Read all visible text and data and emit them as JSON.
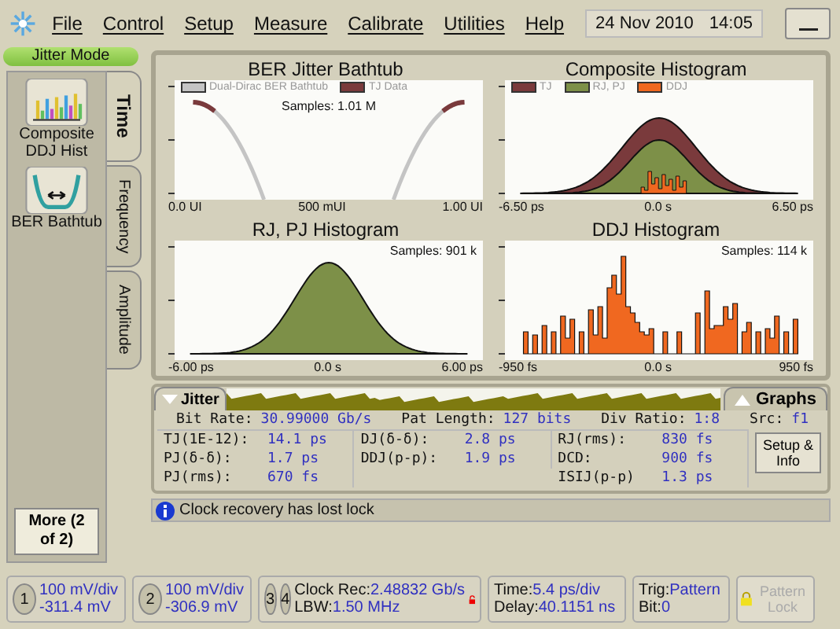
{
  "menu": [
    "File",
    "Control",
    "Setup",
    "Measure",
    "Calibrate",
    "Utilities",
    "Help"
  ],
  "date": "24 Nov 2010",
  "time": "14:05",
  "mode_label": "Jitter Mode",
  "sidebar_buttons": [
    {
      "kind": "histogram",
      "label": "Composite DDJ Hist"
    },
    {
      "kind": "bathtub",
      "label": "BER Bathtub"
    }
  ],
  "more_button": "More (2 of 2)",
  "tabs": [
    {
      "label": "Time",
      "selected": true
    },
    {
      "label": "Frequency",
      "selected": false
    },
    {
      "label": "Amplitude",
      "selected": false
    }
  ],
  "charts": [
    {
      "kind": "bathtub",
      "title": "BER Jitter Bathtub",
      "legend": [
        {
          "label": "Dual-Dirac BER Bathtub",
          "color": "#c4c4c4"
        },
        {
          "label": "TJ Data",
          "color": "#7a3a3c"
        }
      ],
      "samples": "Samples: 1.01 M",
      "x_ticks": [
        "0.0 UI",
        "500 mUI",
        "1.00 UI"
      ]
    },
    {
      "kind": "composite",
      "title": "Composite Histogram",
      "legend": [
        {
          "label": "TJ",
          "color": "#7a3a3c"
        },
        {
          "label": "RJ, PJ",
          "color": "#7d9048"
        },
        {
          "label": "DDJ",
          "color": "#f06820"
        }
      ],
      "x_ticks": [
        "-6.50 ps",
        "0.0 s",
        "6.50 ps"
      ]
    },
    {
      "kind": "gaussian",
      "title": "RJ, PJ Histogram",
      "samples": "Samples: 901 k",
      "x_ticks": [
        "-6.00 ps",
        "0.0 s",
        "6.00 ps"
      ]
    },
    {
      "kind": "ddj",
      "title": "DDJ Histogram",
      "samples": "Samples: 114 k",
      "x_ticks": [
        "-950 fs",
        "0.0 s",
        "950 fs"
      ]
    }
  ],
  "jitter_tab": "Jitter",
  "graphs_tab": "Graphs",
  "info": [
    {
      "label": "Bit Rate:",
      "value": "30.99000 Gb/s"
    },
    {
      "label": "Pat Length:",
      "value": "127 bits"
    },
    {
      "label": "Div Ratio:",
      "value": "1:8"
    },
    {
      "label": "Src:",
      "value": "f1"
    }
  ],
  "results": [
    [
      {
        "label": "TJ(1E-12):",
        "value": "14.1 ps"
      },
      {
        "label": "PJ(δ-δ):",
        "value": "1.7 ps"
      },
      {
        "label": "PJ(rms):",
        "value": "670 fs"
      }
    ],
    [
      {
        "label": "DJ(δ-δ):",
        "value": "2.8 ps"
      },
      {
        "label": "DDJ(p-p):",
        "value": "1.9 ps"
      }
    ],
    [
      {
        "label": "RJ(rms):",
        "value": "830 fs"
      },
      {
        "label": "DCD:",
        "value": "900 fs"
      },
      {
        "label": "ISIJ(p-p)",
        "value": "1.3 ps"
      }
    ]
  ],
  "setup_button": "Setup & Info",
  "message": "Clock recovery has lost lock",
  "status": [
    {
      "kind": "channel",
      "badges": [
        "1"
      ],
      "rows": [
        {
          "value": "100 mV/div"
        },
        {
          "value": "-311.4 mV"
        }
      ]
    },
    {
      "kind": "channel",
      "badges": [
        "2"
      ],
      "rows": [
        {
          "value": "100 mV/div"
        },
        {
          "value": "-306.9 mV"
        }
      ]
    },
    {
      "kind": "clock",
      "badges": [
        "3",
        "4"
      ],
      "rows": [
        {
          "label": "Clock Rec:",
          "value": "2.48832 Gb/s"
        },
        {
          "label": "LBW:",
          "value": "1.50 MHz"
        }
      ],
      "locked": false
    },
    {
      "kind": "timebase",
      "rows": [
        {
          "label": "Time:",
          "value": "5.4 ps/div"
        },
        {
          "label": "Delay:",
          "value": "40.1151 ns"
        }
      ]
    },
    {
      "kind": "trigger",
      "rows": [
        {
          "label": "Trig:",
          "value": "Pattern"
        },
        {
          "label": "Bit:",
          "value": "0"
        }
      ]
    },
    {
      "kind": "lock_button",
      "label": "Pattern Lock",
      "disabled": true
    }
  ]
}
